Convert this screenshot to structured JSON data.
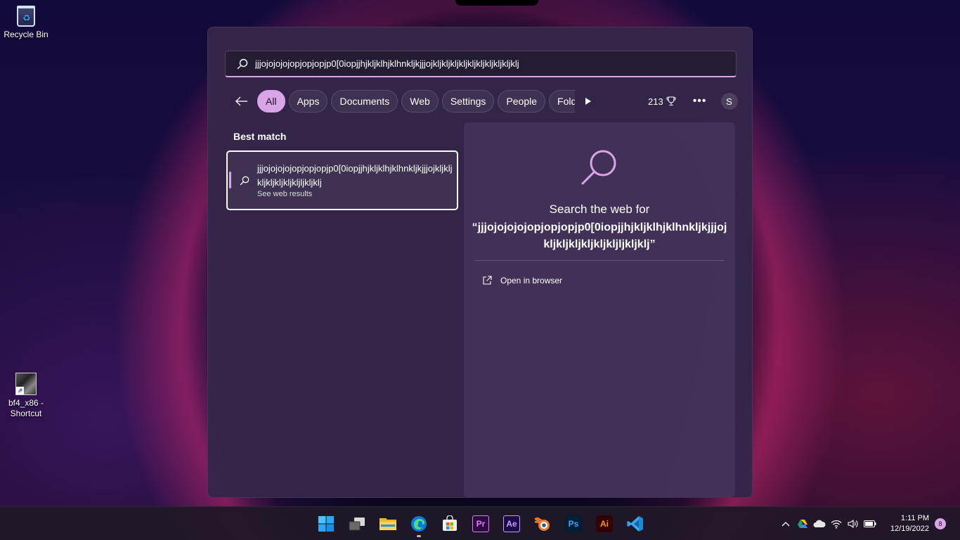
{
  "desktop": {
    "icons": [
      {
        "label": "Recycle Bin",
        "icon": "recycle-bin-icon"
      },
      {
        "label": "bf4_x86 - Shortcut",
        "icon": "game-shortcut-icon"
      }
    ]
  },
  "search": {
    "query": "jjjojojojojopjopjopjp0[0iopjjhjkljklhjklhnkljkjjjojkljkljkljkljkljkljkljkljkljklj"
  },
  "filters": {
    "chips": [
      "All",
      "Apps",
      "Documents",
      "Web",
      "Settings",
      "People",
      "Folde"
    ],
    "active": "All",
    "points": "213",
    "avatar_letter": "S"
  },
  "best_match": {
    "heading": "Best match",
    "title": "jjjojojojojopjopjopjp0[0iopjjhjkljklhjklhnkljkjjjojkljkljkljkljkljkljkljljkljklj",
    "subtitle": "See web results"
  },
  "preview": {
    "title": "Search the web for",
    "query": "“jjjojojojojopjopjopjp0[0iopjjhjkljklhjklhnkljkjjjojkljkljkljkljkljkljljkljklj”",
    "open_label": "Open in browser"
  },
  "taskbar": {
    "apps": [
      "start-icon",
      "task-view-icon",
      "file-explorer-icon",
      "edge-icon",
      "store-icon",
      "premiere-icon",
      "after-effects-icon",
      "blender-icon",
      "photoshop-icon",
      "illustrator-icon",
      "vscode-icon"
    ],
    "pr_label": "Pr",
    "ae_label": "Ae",
    "ps_label": "Ps",
    "ai_label": "Ai",
    "time": "1:11 PM",
    "date": "12/19/2022",
    "notifications": "8"
  },
  "colors": {
    "accent": "#d9a5e6",
    "panel": "#342648"
  }
}
